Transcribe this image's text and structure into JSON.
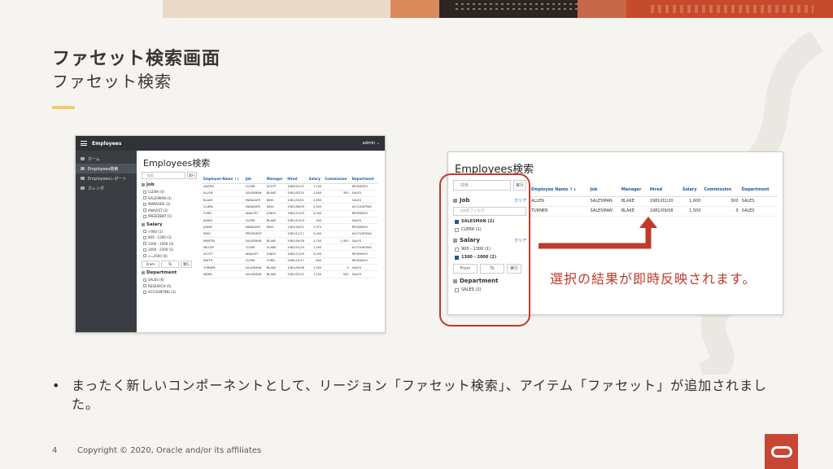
{
  "slide": {
    "title": "ファセット検索画面",
    "subtitle": "ファセット検索",
    "page_number": "4",
    "copyright": "Copyright © 2020, Oracle and/or its affiliates",
    "result_text": "選択の結果が即時反映されます。",
    "bullet": "まったく新しいコンポーネントとして、リージョン「ファセット検索」、アイテム「ファセット」が追加されました。",
    "colors": {
      "accent": "#f0cc71",
      "highlight": "#c0392b",
      "oracle_red": "#c74634"
    }
  },
  "left_app": {
    "app_title": "Employees",
    "user": "admin ⌄",
    "nav": [
      {
        "label": "ホーム",
        "icon": "home-icon"
      },
      {
        "label": "Employees検索",
        "icon": "search-icon"
      },
      {
        "label": "Employeesレポート",
        "icon": "report-icon"
      },
      {
        "label": "カレンダ",
        "icon": "calendar-icon"
      }
    ],
    "region_title": "Employees検索",
    "search_placeholder": "検索...",
    "search_button": "実行",
    "facets": {
      "job": {
        "label": "Job",
        "options": [
          "CLERK (4)",
          "SALESMAN (4)",
          "MANAGER (3)",
          "ANALYST (2)",
          "PRESIDENT (1)"
        ]
      },
      "salary": {
        "label": "Salary",
        "options": [
          "<900 (1)",
          "900 - 1300 (3)",
          "1300 - 2000 (3)",
          "2000 - 2500 (1)",
          ">=2500 (6)"
        ],
        "from": "From",
        "to": "To",
        "apply": "実行"
      },
      "department": {
        "label": "Department",
        "options": [
          "SALES (6)",
          "RESEARCH (5)",
          "ACCOUNTING (3)"
        ]
      }
    },
    "table": {
      "headers": [
        "Employee Name ↑↓",
        "Job",
        "Manager",
        "Hired",
        "Salary",
        "Commission",
        "Department"
      ],
      "rows": [
        [
          "ADAMS",
          "CLERK",
          "SCOTT",
          "1983/01/12",
          "1,100",
          "",
          "RESEARCH"
        ],
        [
          "ALLEN",
          "SALESMAN",
          "BLAKE",
          "1981/02/20",
          "1,600",
          "300",
          "SALES"
        ],
        [
          "BLAKE",
          "MANAGER",
          "KING",
          "1981/05/01",
          "2,850",
          "",
          "SALES"
        ],
        [
          "CLARK",
          "MANAGER",
          "KING",
          "1981/06/09",
          "2,450",
          "",
          "ACCOUNTING"
        ],
        [
          "FORD",
          "ANALYST",
          "JONES",
          "1981/12/03",
          "3,000",
          "",
          "RESEARCH"
        ],
        [
          "JAMES",
          "CLERK",
          "BLAKE",
          "1981/12/03",
          "950",
          "",
          "SALES"
        ],
        [
          "JONES",
          "MANAGER",
          "KING",
          "1981/04/02",
          "2,975",
          "",
          "RESEARCH"
        ],
        [
          "KING",
          "PRESIDENT",
          "",
          "1981/11/17",
          "5,000",
          "",
          "ACCOUNTING"
        ],
        [
          "MARTIN",
          "SALESMAN",
          "BLAKE",
          "1981/09/28",
          "1,250",
          "1,400",
          "SALES"
        ],
        [
          "MILLER",
          "CLERK",
          "CLARK",
          "1982/01/23",
          "1,300",
          "",
          "ACCOUNTING"
        ],
        [
          "SCOTT",
          "ANALYST",
          "JONES",
          "1982/12/09",
          "3,000",
          "",
          "RESEARCH"
        ],
        [
          "SMITH",
          "CLERK",
          "FORD",
          "1980/12/17",
          "800",
          "",
          "RESEARCH"
        ],
        [
          "TURNER",
          "SALESMAN",
          "BLAKE",
          "1981/09/08",
          "1,500",
          "0",
          "SALES"
        ],
        [
          "WARD",
          "SALESMAN",
          "BLAKE",
          "1981/02/22",
          "1,250",
          "500",
          "SALES"
        ]
      ]
    }
  },
  "right_app": {
    "region_title": "Employees検索",
    "search_placeholder": "検索...",
    "search_button": "実行",
    "clear_label": "クリア",
    "job_filter_placeholder": "Jobのフィルタ",
    "facets": {
      "job": {
        "label": "Job",
        "options": [
          {
            "label": "SALESMAN (2)",
            "checked": true
          },
          {
            "label": "CLERK (1)",
            "checked": false
          }
        ]
      },
      "salary": {
        "label": "Salary",
        "options": [
          {
            "label": "900 - 1300 (1)",
            "checked": false
          },
          {
            "label": "1300 - 2000 (2)",
            "checked": true
          }
        ],
        "from": "From",
        "to": "To",
        "apply": "実行"
      },
      "department": {
        "label": "Department",
        "options": [
          {
            "label": "SALES (2)",
            "checked": false
          }
        ]
      }
    },
    "table": {
      "headers": [
        "Employee Name ↑↓",
        "Job",
        "Manager",
        "Hired",
        "Salary",
        "Commission",
        "Department"
      ],
      "rows": [
        [
          "ALLEN",
          "SALESMAN",
          "BLAKE",
          "1981/02/20",
          "1,600",
          "300",
          "SALES"
        ],
        [
          "TURNER",
          "SALESMAN",
          "BLAKE",
          "1981/09/08",
          "1,500",
          "0",
          "SALES"
        ]
      ]
    }
  }
}
